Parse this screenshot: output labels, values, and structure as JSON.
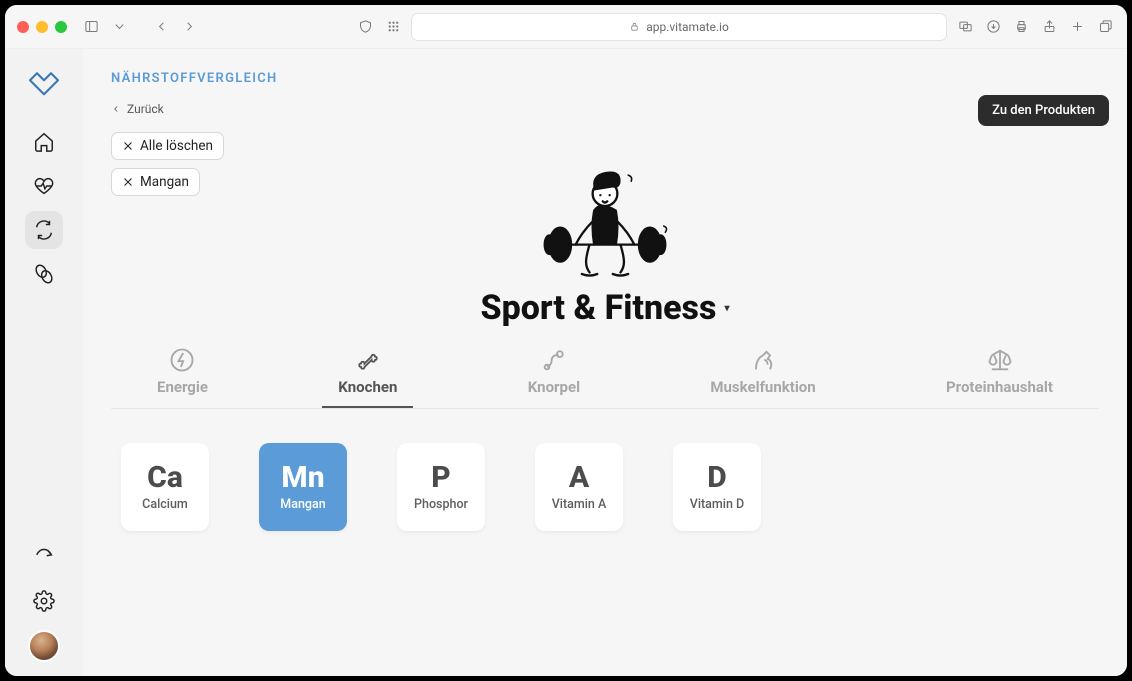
{
  "browser": {
    "url_display": "app.vitamate.io"
  },
  "sidebar": {
    "items": [
      {
        "id": "home",
        "label": "Home"
      },
      {
        "id": "health",
        "label": "Health"
      },
      {
        "id": "compare",
        "label": "Compare",
        "active": true
      },
      {
        "id": "products",
        "label": "Products"
      }
    ]
  },
  "header": {
    "breadcrumb": "NÄHRSTOFFVERGLEICH",
    "back_label": "Zurück",
    "cta_label": "Zu den Produkten"
  },
  "filter_chips": [
    {
      "id": "clear",
      "label": "Alle löschen"
    },
    {
      "id": "mangan",
      "label": "Mangan"
    }
  ],
  "category": {
    "title": "Sport & Fitness"
  },
  "tabs": [
    {
      "id": "energie",
      "label": "Energie",
      "active": false
    },
    {
      "id": "knochen",
      "label": "Knochen",
      "active": true
    },
    {
      "id": "knorpel",
      "label": "Knorpel",
      "active": false
    },
    {
      "id": "muskel",
      "label": "Muskelfunktion",
      "active": false
    },
    {
      "id": "protein",
      "label": "Proteinhaushalt",
      "active": false
    }
  ],
  "nutrients": [
    {
      "symbol": "Ca",
      "name": "Calcium",
      "selected": false
    },
    {
      "symbol": "Mn",
      "name": "Mangan",
      "selected": true
    },
    {
      "symbol": "P",
      "name": "Phosphor",
      "selected": false
    },
    {
      "symbol": "A",
      "name": "Vitamin A",
      "selected": false
    },
    {
      "symbol": "D",
      "name": "Vitamin D",
      "selected": false
    }
  ],
  "colors": {
    "accent": "#5a9bd8",
    "dark": "#2c2c2c"
  }
}
